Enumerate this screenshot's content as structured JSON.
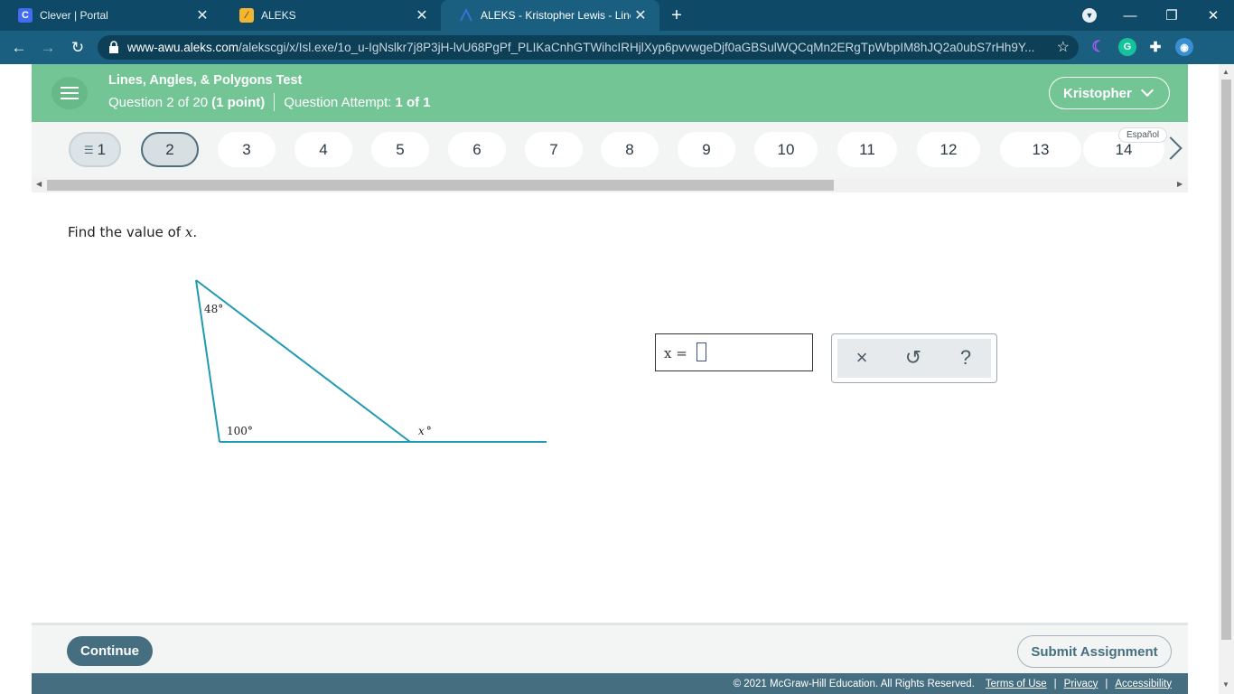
{
  "browser": {
    "tabs": [
      {
        "title": "Clever | Portal",
        "favicon": "C",
        "active": false
      },
      {
        "title": "ALEKS",
        "favicon": "aleks-logo",
        "active": false
      },
      {
        "title": "ALEKS - Kristopher Lewis - Lines,",
        "favicon": "aleks-a",
        "active": true
      }
    ],
    "url_host": "www-awu.aleks.com",
    "url_path": "/alekscgi/x/Isl.exe/1o_u-IgNslkr7j8P3jH-lvU68PgPf_PLIKaCnhGTWihcIRHjlXyp6pvvwgeDjf0aGBSulWQCqMn2ERgTpWbpIM8hJQ2a0ubS7rHh9Y..."
  },
  "header": {
    "title": "Lines, Angles, & Polygons Test",
    "question_prefix": "Question 2 of 20",
    "points": "(1 point)",
    "attempt_label": "Question Attempt:",
    "attempt_value": "1 of 1",
    "user": "Kristopher"
  },
  "qnav": {
    "items": [
      "1",
      "2",
      "3",
      "4",
      "5",
      "6",
      "7",
      "8",
      "9",
      "10",
      "11",
      "12",
      "13",
      "14"
    ],
    "current": "2",
    "language_link": "Español"
  },
  "problem": {
    "prompt_text": "Find the value of ",
    "prompt_var": "x",
    "prompt_end": ".",
    "figure": {
      "angle_top": "48°",
      "angle_bottom_left": "100°",
      "angle_exterior_var": "x",
      "angle_exterior_deg": "°",
      "stroke_color": "#1f9bb0"
    },
    "answer_label": "x =",
    "answer_value": ""
  },
  "tools": {
    "clear_icon": "×",
    "undo_icon": "↺",
    "help_icon": "?"
  },
  "footer": {
    "continue_label": "Continue",
    "submit_label": "Submit Assignment",
    "copyright": "© 2021 McGraw-Hill Education. All Rights Reserved.",
    "links": [
      "Terms of Use",
      "Privacy",
      "Accessibility"
    ]
  }
}
